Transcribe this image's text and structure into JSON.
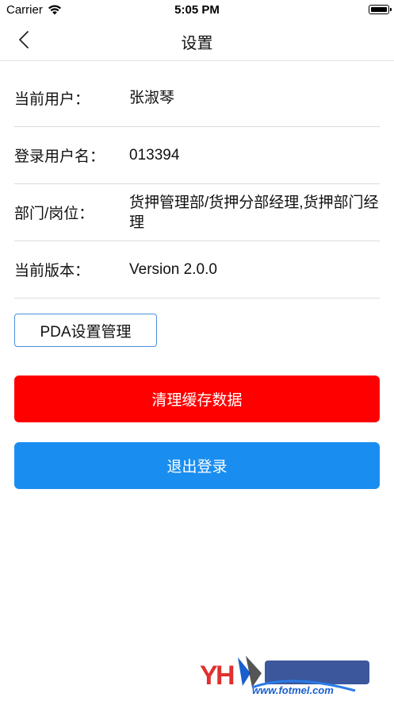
{
  "status_bar": {
    "carrier": "Carrier",
    "time": "5:05 PM"
  },
  "nav": {
    "title": "设置"
  },
  "info": [
    {
      "label": "当前用户：",
      "value": "张淑琴"
    },
    {
      "label": "登录用户名：",
      "value": "013394"
    },
    {
      "label": "部门/岗位：",
      "value": "货押管理部/货押分部经理,货押部门经理"
    },
    {
      "label": "当前版本：",
      "value": "Version 2.0.0"
    }
  ],
  "buttons": {
    "pda_settings": "PDA设置管理",
    "clear_cache": "清理缓存数据",
    "logout": "退出登录"
  },
  "colors": {
    "clear_cache_bg": "#ff0000",
    "logout_bg": "#1a8ef0",
    "pda_border": "#4a90d9"
  },
  "watermark": {
    "text": "www.fotmel.com"
  }
}
